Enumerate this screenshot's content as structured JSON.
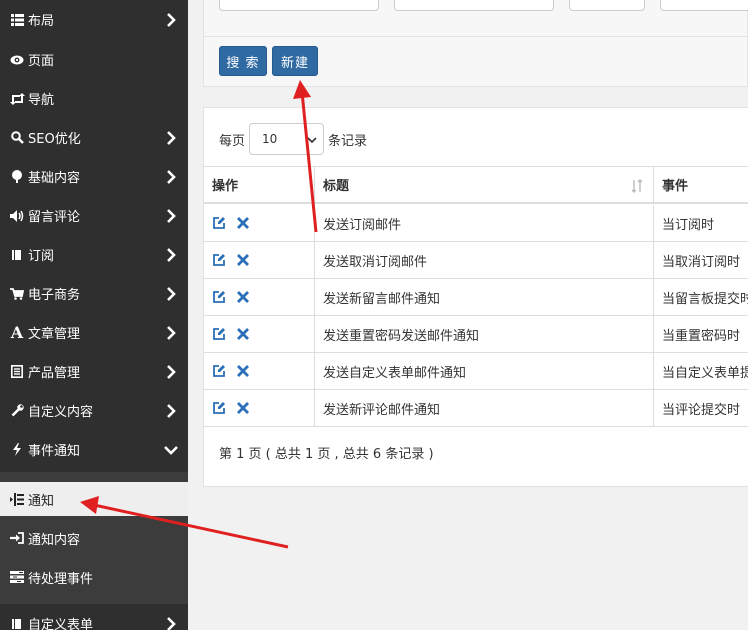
{
  "sidebar": {
    "items": [
      {
        "label": "布局",
        "icon": "list-icon",
        "chevron": "right"
      },
      {
        "label": "页面",
        "icon": "eye-icon",
        "chevron": "none"
      },
      {
        "label": "导航",
        "icon": "retweet-icon",
        "chevron": "none"
      },
      {
        "label": "SEO优化",
        "icon": "search-icon",
        "chevron": "right"
      },
      {
        "label": "基础内容",
        "icon": "tree-icon",
        "chevron": "right"
      },
      {
        "label": "留言评论",
        "icon": "volume-icon",
        "chevron": "right"
      },
      {
        "label": "订阅",
        "icon": "book-icon",
        "chevron": "right"
      },
      {
        "label": "电子商务",
        "icon": "cart-icon",
        "chevron": "right"
      },
      {
        "label": "文章管理",
        "icon": "font-icon",
        "chevron": "right"
      },
      {
        "label": "产品管理",
        "icon": "list-alt-icon",
        "chevron": "right"
      },
      {
        "label": "自定义内容",
        "icon": "wrench-icon",
        "chevron": "right"
      },
      {
        "label": "事件通知",
        "icon": "bolt-icon",
        "chevron": "down"
      }
    ],
    "sub_items": [
      {
        "label": "通知",
        "icon": "indent-icon",
        "active": true
      },
      {
        "label": "通知内容",
        "icon": "sign-in-icon",
        "active": false
      },
      {
        "label": "待处理事件",
        "icon": "tasks-icon",
        "active": false
      }
    ],
    "bottom_item": {
      "label": "自定义表单",
      "icon": "book-icon",
      "chevron": "right"
    }
  },
  "toolbar": {
    "search_label": "搜 索",
    "new_label": "新建"
  },
  "table": {
    "page_size_prefix": "每页",
    "page_size_value": "10",
    "page_size_suffix": "条记录",
    "headers": [
      "操作",
      "标题",
      "事件"
    ],
    "rows": [
      {
        "title": "发送订阅邮件",
        "event": "当订阅时"
      },
      {
        "title": "发送取消订阅邮件",
        "event": "当取消订阅时"
      },
      {
        "title": "发送新留言邮件通知",
        "event": "当留言板提交时"
      },
      {
        "title": "发送重置密码发送邮件通知",
        "event": "当重置密码时"
      },
      {
        "title": "发送自定义表单邮件通知",
        "event": "当自定义表单提交时"
      },
      {
        "title": "发送新评论邮件通知",
        "event": "当评论提交时"
      }
    ],
    "footer": "第 1 页 ( 总共 1 页 , 总共 6 条记录 )"
  },
  "colors": {
    "sidebar_bg": "#2f2f2f",
    "submenu_bg": "#3c3c3c",
    "primary_button": "#2f6aa3",
    "action_icon": "#2a6fb7",
    "annotation_arrow": "#e02020"
  }
}
